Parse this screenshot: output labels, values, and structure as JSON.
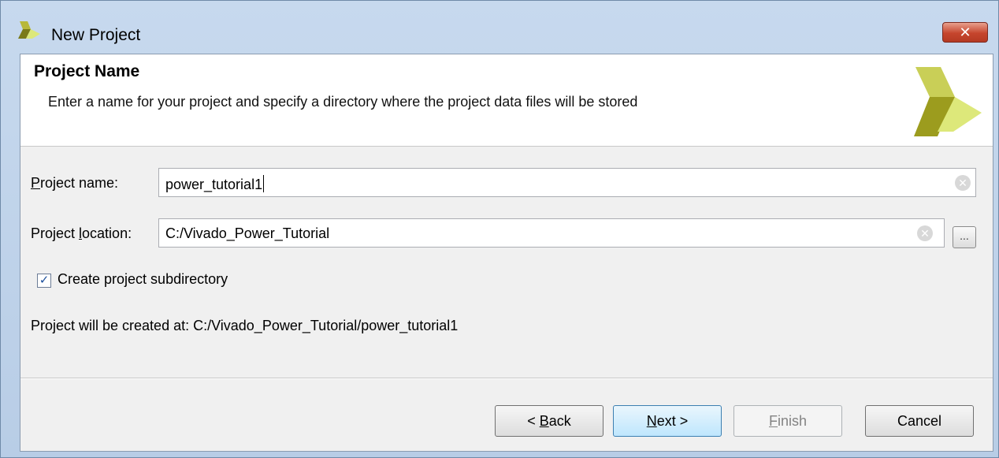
{
  "window": {
    "title": "New Project",
    "close_label": "✕"
  },
  "header": {
    "title": "Project Name",
    "description": "Enter a name for your project and specify a directory where the project data files will be stored"
  },
  "form": {
    "project_name": {
      "label_u": "P",
      "label_rest": "roject name:",
      "value": "power_tutorial1"
    },
    "project_location": {
      "label_pre": "Project ",
      "label_u": "l",
      "label_rest": "ocation:",
      "value": "C:/Vivado_Power_Tutorial",
      "browse_label": "..."
    },
    "create_subdirectory": {
      "label": "Create project subdirectory",
      "checked": true
    },
    "created_at": "Project will be created at: C:/Vivado_Power_Tutorial/power_tutorial1"
  },
  "buttons": {
    "back": {
      "pre": "< ",
      "u": "B",
      "rest": "ack"
    },
    "next": {
      "u": "N",
      "rest": "ext >"
    },
    "finish": {
      "u": "F",
      "rest": "inish"
    },
    "cancel": {
      "label": "Cancel"
    }
  },
  "icons": {
    "app": "vivado-logo-icon",
    "header_logo": "vivado-logo-icon",
    "clear": "clear-icon",
    "check": "checkmark-icon"
  },
  "colors": {
    "title_bar": "#c7d9ee",
    "close_button": "#c6452d",
    "logo_dark": "#9c9c1e",
    "logo_light": "#dde87a",
    "default_button": "#bee6fd"
  }
}
